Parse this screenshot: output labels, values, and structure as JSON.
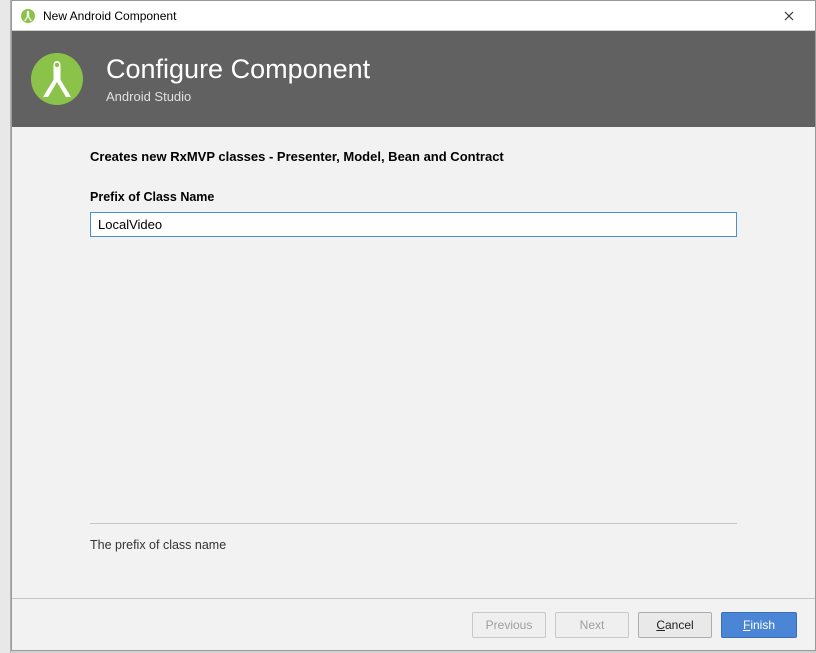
{
  "titlebar": {
    "title": "New Android Component"
  },
  "banner": {
    "heading": "Configure Component",
    "subheading": "Android Studio"
  },
  "content": {
    "description": "Creates new RxMVP classes - Presenter, Model, Bean and Contract",
    "field_label": "Prefix of Class Name",
    "field_value": "LocalVideo",
    "help_text": "The prefix of class name"
  },
  "footer": {
    "previous": "Previous",
    "next": "Next",
    "cancel_mnemonic": "C",
    "cancel_rest": "ancel",
    "finish_mnemonic": "F",
    "finish_rest": "inish"
  }
}
